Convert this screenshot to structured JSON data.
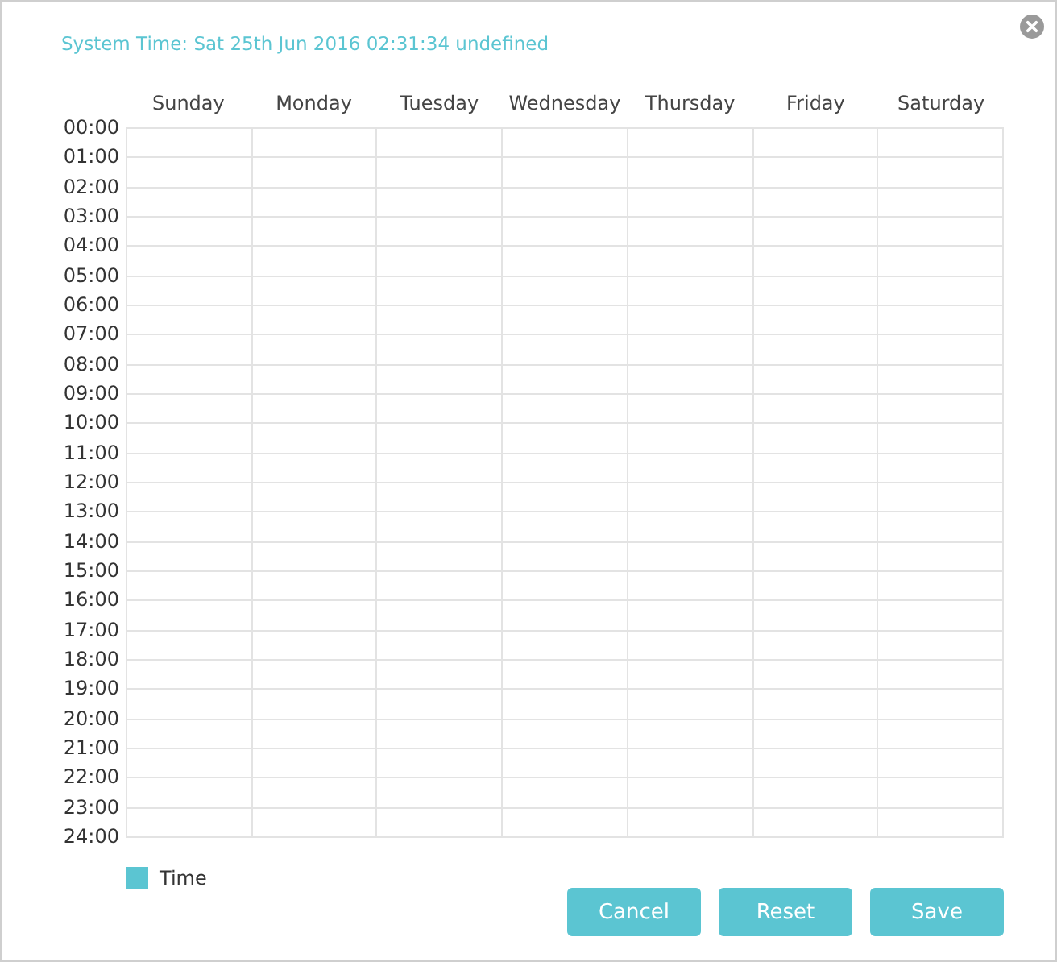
{
  "system_time": "System Time: Sat 25th Jun 2016 02:31:34 undefined",
  "days": [
    "Sunday",
    "Monday",
    "Tuesday",
    "Wednesday",
    "Thursday",
    "Friday",
    "Saturday"
  ],
  "hours": [
    "00:00",
    "01:00",
    "02:00",
    "03:00",
    "04:00",
    "05:00",
    "06:00",
    "07:00",
    "08:00",
    "09:00",
    "10:00",
    "11:00",
    "12:00",
    "13:00",
    "14:00",
    "15:00",
    "16:00",
    "17:00",
    "18:00",
    "19:00",
    "20:00",
    "21:00",
    "22:00",
    "23:00",
    "24:00"
  ],
  "legend": {
    "label": "Time",
    "color": "#5bc5d2"
  },
  "buttons": [
    "Cancel",
    "Reset",
    "Save"
  ]
}
